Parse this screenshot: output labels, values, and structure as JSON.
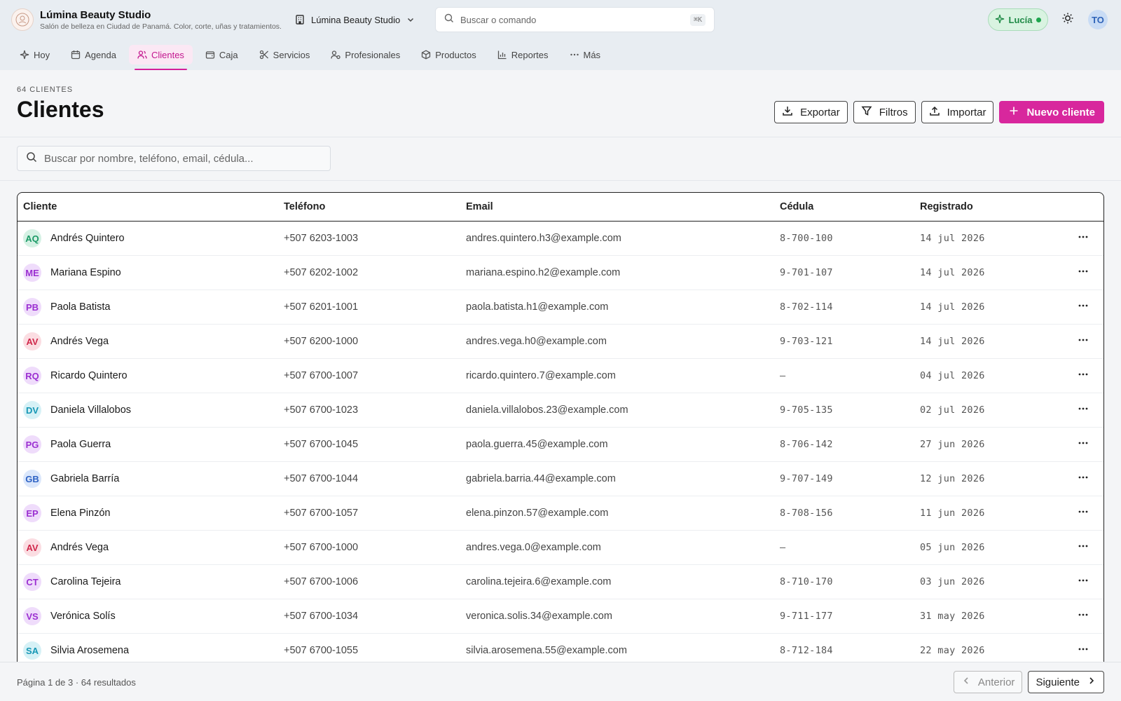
{
  "app": {
    "name": "Lúmina Beauty Studio",
    "tagline": "Salón de belleza en Ciudad de Panamá. Color, corte, uñas y tratamientos.",
    "studio_selector": "Lúmina Beauty Studio"
  },
  "command": {
    "placeholder": "Buscar o comando",
    "shortcut": "⌘K"
  },
  "assistant": {
    "label": "Lucía"
  },
  "user": {
    "initials": "TO"
  },
  "nav": [
    {
      "label": "Hoy",
      "icon": "sparkle-icon"
    },
    {
      "label": "Agenda",
      "icon": "calendar-icon"
    },
    {
      "label": "Clientes",
      "icon": "users-icon",
      "active": true
    },
    {
      "label": "Caja",
      "icon": "wallet-icon"
    },
    {
      "label": "Servicios",
      "icon": "scissors-icon"
    },
    {
      "label": "Profesionales",
      "icon": "professionals-icon"
    },
    {
      "label": "Productos",
      "icon": "box-icon"
    },
    {
      "label": "Reportes",
      "icon": "chart-icon"
    },
    {
      "label": "Más",
      "icon": "more-icon"
    }
  ],
  "page": {
    "count": "64 CLIENTES",
    "title": "Clientes",
    "actions": {
      "export": "Exportar",
      "filters": "Filtros",
      "import": "Importar",
      "new": "Nuevo cliente"
    }
  },
  "search": {
    "placeholder": "Buscar por nombre, teléfono, email, cédula..."
  },
  "table": {
    "columns": {
      "client": "Cliente",
      "phone": "Teléfono",
      "email": "Email",
      "id": "Cédula",
      "registered": "Registrado"
    },
    "rows": [
      {
        "initials": "AQ",
        "color": "teal",
        "name": "Andrés Quintero",
        "phone": "+507 6203-1003",
        "email": "andres.quintero.h3@example.com",
        "id": "8-700-100",
        "registered": "14 jul 2026"
      },
      {
        "initials": "ME",
        "color": "purple",
        "name": "Mariana Espino",
        "phone": "+507 6202-1002",
        "email": "mariana.espino.h2@example.com",
        "id": "9-701-107",
        "registered": "14 jul 2026"
      },
      {
        "initials": "PB",
        "color": "purple",
        "name": "Paola Batista",
        "phone": "+507 6201-1001",
        "email": "paola.batista.h1@example.com",
        "id": "8-702-114",
        "registered": "14 jul 2026"
      },
      {
        "initials": "AV",
        "color": "red",
        "name": "Andrés Vega",
        "phone": "+507 6200-1000",
        "email": "andres.vega.h0@example.com",
        "id": "9-703-121",
        "registered": "14 jul 2026"
      },
      {
        "initials": "RQ",
        "color": "purple",
        "name": "Ricardo Quintero",
        "phone": "+507 6700-1007",
        "email": "ricardo.quintero.7@example.com",
        "id": "—",
        "registered": "04 jul 2026"
      },
      {
        "initials": "DV",
        "color": "cyan",
        "name": "Daniela Villalobos",
        "phone": "+507 6700-1023",
        "email": "daniela.villalobos.23@example.com",
        "id": "9-705-135",
        "registered": "02 jul 2026"
      },
      {
        "initials": "PG",
        "color": "purple",
        "name": "Paola Guerra",
        "phone": "+507 6700-1045",
        "email": "paola.guerra.45@example.com",
        "id": "8-706-142",
        "registered": "27 jun 2026"
      },
      {
        "initials": "GB",
        "color": "blue",
        "name": "Gabriela Barría",
        "phone": "+507 6700-1044",
        "email": "gabriela.barria.44@example.com",
        "id": "9-707-149",
        "registered": "12 jun 2026"
      },
      {
        "initials": "EP",
        "color": "purple",
        "name": "Elena Pinzón",
        "phone": "+507 6700-1057",
        "email": "elena.pinzon.57@example.com",
        "id": "8-708-156",
        "registered": "11 jun 2026"
      },
      {
        "initials": "AV",
        "color": "red",
        "name": "Andrés Vega",
        "phone": "+507 6700-1000",
        "email": "andres.vega.0@example.com",
        "id": "—",
        "registered": "05 jun 2026"
      },
      {
        "initials": "CT",
        "color": "purple",
        "name": "Carolina Tejeira",
        "phone": "+507 6700-1006",
        "email": "carolina.tejeira.6@example.com",
        "id": "8-710-170",
        "registered": "03 jun 2026"
      },
      {
        "initials": "VS",
        "color": "purple",
        "name": "Verónica Solís",
        "phone": "+507 6700-1034",
        "email": "veronica.solis.34@example.com",
        "id": "9-711-177",
        "registered": "31 may 2026"
      },
      {
        "initials": "SA",
        "color": "cyan",
        "name": "Silvia Arosemena",
        "phone": "+507 6700-1055",
        "email": "silvia.arosemena.55@example.com",
        "id": "8-712-184",
        "registered": "22 may 2026"
      }
    ]
  },
  "pagination": {
    "info": "Página 1 de 3 · 64 resultados",
    "prev": "Anterior",
    "next": "Siguiente"
  },
  "colors": {
    "accent": "#d8279d",
    "assistant": "#1f8a46"
  }
}
